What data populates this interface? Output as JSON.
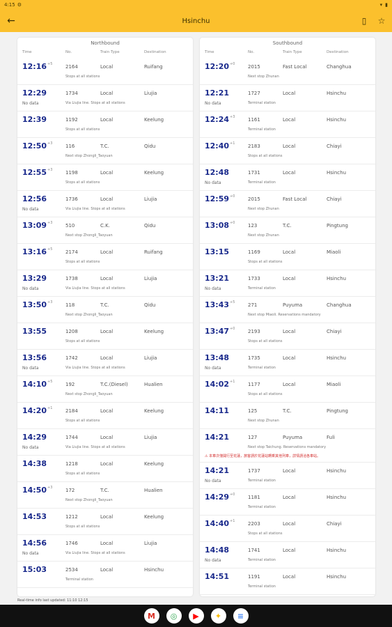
{
  "status": {
    "time": "4:15",
    "gear": "⚙",
    "wifi": "▾",
    "battery": "▮"
  },
  "header": {
    "title": "Hsinchu",
    "back_icon": "←",
    "bookmark_icon": "▯",
    "star_icon": "☆"
  },
  "north": {
    "title": "Northbound",
    "cols": {
      "time": "Time",
      "no": "No.",
      "type": "Train Type",
      "dest": "Destination"
    },
    "rows": [
      {
        "time": "12:16",
        "delay": "+5",
        "late": "",
        "no": "2164",
        "type": "Local",
        "dest": "Ruifang",
        "note": "Stops at all stations"
      },
      {
        "time": "12:29",
        "delay": "",
        "late": "No data",
        "no": "1734",
        "type": "Local",
        "dest": "Liujia",
        "note": "Via Liujia line. Stops at all stations"
      },
      {
        "time": "12:39",
        "delay": "",
        "late": "",
        "no": "1192",
        "type": "Local",
        "dest": "Keelung",
        "note": "Stops at all stations"
      },
      {
        "time": "12:50",
        "delay": "+3",
        "late": "",
        "no": "116",
        "type": "T.C.",
        "dest": "Qidu",
        "note": "Next stop Zhongli_Taoyuan"
      },
      {
        "time": "12:55",
        "delay": "+3",
        "late": "",
        "no": "1198",
        "type": "Local",
        "dest": "Keelung",
        "note": "Stops at all stations"
      },
      {
        "time": "12:56",
        "delay": "",
        "late": "No data",
        "no": "1736",
        "type": "Local",
        "dest": "Liujia",
        "note": "Via Liujia line. Stops at all stations"
      },
      {
        "time": "13:09",
        "delay": "+3",
        "late": "",
        "no": "510",
        "type": "C.K.",
        "dest": "Qidu",
        "note": "Next stop Zhongli_Taoyuan"
      },
      {
        "time": "13:16",
        "delay": "+5",
        "late": "",
        "no": "2174",
        "type": "Local",
        "dest": "Ruifang",
        "note": "Stops at all stations"
      },
      {
        "time": "13:29",
        "delay": "",
        "late": "No data",
        "no": "1738",
        "type": "Local",
        "dest": "Liujia",
        "note": "Via Liujia line. Stops at all stations"
      },
      {
        "time": "13:50",
        "delay": "+3",
        "late": "",
        "no": "118",
        "type": "T.C.",
        "dest": "Qidu",
        "note": "Next stop Zhongli_Taoyuan"
      },
      {
        "time": "13:55",
        "delay": "",
        "late": "",
        "no": "1208",
        "type": "Local",
        "dest": "Keelung",
        "note": "Stops at all stations"
      },
      {
        "time": "13:56",
        "delay": "",
        "late": "No data",
        "no": "1742",
        "type": "Local",
        "dest": "Liujia",
        "note": "Via Liujia line. Stops at all stations"
      },
      {
        "time": "14:10",
        "delay": "+5",
        "late": "",
        "no": "192",
        "type": "T.C.(Diesel)",
        "dest": "Hualien",
        "note": "Next stop Zhongli_Taoyuan"
      },
      {
        "time": "14:20",
        "delay": "+1",
        "late": "",
        "no": "2184",
        "type": "Local",
        "dest": "Keelung",
        "note": "Stops at all stations"
      },
      {
        "time": "14:29",
        "delay": "",
        "late": "No data",
        "no": "1744",
        "type": "Local",
        "dest": "Liujia",
        "note": "Via Liujia line. Stops at all stations"
      },
      {
        "time": "14:38",
        "delay": "",
        "late": "",
        "no": "1218",
        "type": "Local",
        "dest": "Keelung",
        "note": "Stops at all stations"
      },
      {
        "time": "14:50",
        "delay": "+3",
        "late": "",
        "no": "172",
        "type": "T.C.",
        "dest": "Hualien",
        "note": "Next stop Zhongli_Taoyuan"
      },
      {
        "time": "14:53",
        "delay": "",
        "late": "",
        "no": "1212",
        "type": "Local",
        "dest": "Keelung",
        "note": "Stops at all stations"
      },
      {
        "time": "14:56",
        "delay": "",
        "late": "No data",
        "no": "1746",
        "type": "Local",
        "dest": "Liujia",
        "note": "Via Liujia line. Stops at all stations"
      },
      {
        "time": "15:03",
        "delay": "",
        "late": "",
        "no": "2534",
        "type": "Local",
        "dest": "Hsinchu",
        "note": "Terminal station"
      }
    ]
  },
  "south": {
    "title": "Southbound",
    "cols": {
      "time": "Time",
      "no": "No.",
      "type": "Train Type",
      "dest": "Destination"
    },
    "rows": [
      {
        "time": "12:20",
        "delay": "+0",
        "late": "",
        "no": "2015",
        "type": "Fast Local",
        "dest": "Changhua",
        "note": "Next stop Zhunan"
      },
      {
        "time": "12:21",
        "delay": "",
        "late": "No data",
        "no": "1727",
        "type": "Local",
        "dest": "Hsinchu",
        "note": "Terminal station"
      },
      {
        "time": "12:24",
        "delay": "+3",
        "late": "",
        "no": "1161",
        "type": "Local",
        "dest": "Hsinchu",
        "note": "Terminal station"
      },
      {
        "time": "12:40",
        "delay": "+1",
        "late": "",
        "no": "2183",
        "type": "Local",
        "dest": "Chiayi",
        "note": "Stops at all stations"
      },
      {
        "time": "12:48",
        "delay": "",
        "late": "No data",
        "no": "1731",
        "type": "Local",
        "dest": "Hsinchu",
        "note": "Terminal station"
      },
      {
        "time": "12:59",
        "delay": "+0",
        "late": "",
        "no": "2015",
        "type": "Fast Local",
        "dest": "Chiayi",
        "note": "Next stop Zhunan"
      },
      {
        "time": "13:08",
        "delay": "+0",
        "late": "",
        "no": "123",
        "type": "T.C.",
        "dest": "Pingtung",
        "note": "Next stop Zhunan"
      },
      {
        "time": "13:15",
        "delay": "",
        "late": "",
        "no": "1169",
        "type": "Local",
        "dest": "Miaoli",
        "note": "Stops at all stations"
      },
      {
        "time": "13:21",
        "delay": "",
        "late": "No data",
        "no": "1733",
        "type": "Local",
        "dest": "Hsinchu",
        "note": "Terminal station"
      },
      {
        "time": "13:43",
        "delay": "+5",
        "late": "",
        "no": "271",
        "type": "Puyuma",
        "dest": "Changhua",
        "note": "Next stop Miaoli. Reservations mandatory"
      },
      {
        "time": "13:47",
        "delay": "+0",
        "late": "",
        "no": "2193",
        "type": "Local",
        "dest": "Chiayi",
        "note": "Stops at all stations"
      },
      {
        "time": "13:48",
        "delay": "",
        "late": "No data",
        "no": "1735",
        "type": "Local",
        "dest": "Hsinchu",
        "note": "Terminal station"
      },
      {
        "time": "14:02",
        "delay": "+1",
        "late": "",
        "no": "1177",
        "type": "Local",
        "dest": "Miaoli",
        "note": "Stops at all stations"
      },
      {
        "time": "14:11",
        "delay": "",
        "late": "",
        "no": "125",
        "type": "T.C.",
        "dest": "Pingtung",
        "note": "Next stop Zhunan"
      },
      {
        "time": "14:21",
        "delay": "",
        "late": "",
        "no": "127",
        "type": "Puyuma",
        "dest": "Fuli",
        "note": "Next stop Taichung. Reservations mandatory",
        "warn": "⚠ 本車次僅開行至花蓮，旅客請於花蓮站轉乘其他列車，詳情請洽各車站。"
      },
      {
        "time": "14:21",
        "delay": "",
        "late": "No data",
        "no": "1737",
        "type": "Local",
        "dest": "Hsinchu",
        "note": "Terminal station"
      },
      {
        "time": "14:29",
        "delay": "+0",
        "late": "",
        "no": "1181",
        "type": "Local",
        "dest": "Hsinchu",
        "note": "Terminal station"
      },
      {
        "time": "14:40",
        "delay": "+1",
        "late": "",
        "no": "2203",
        "type": "Local",
        "dest": "Chiayi",
        "note": "Stops at all stations"
      },
      {
        "time": "14:48",
        "delay": "",
        "late": "No data",
        "no": "1741",
        "type": "Local",
        "dest": "Hsinchu",
        "note": "Terminal station"
      },
      {
        "time": "14:51",
        "delay": "",
        "late": "",
        "no": "1191",
        "type": "Local",
        "dest": "Hsinchu",
        "note": "Terminal station"
      }
    ]
  },
  "footer": {
    "text": "Real-time info last updated: 11:10 12:15"
  },
  "dock": [
    "M",
    "◎",
    "▶",
    "✦",
    "≡"
  ]
}
